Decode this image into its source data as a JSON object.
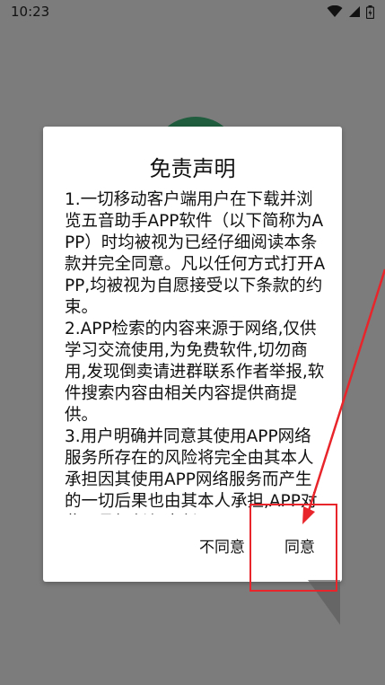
{
  "status_bar": {
    "time": "10:23"
  },
  "dialog": {
    "title": "免责声明",
    "body": "1.一切移动客户端用户在下载并浏览五音助手APP软件（以下简称为APP）时均被视为已经仔细阅读本条款并完全同意。凡以任何方式打开APP,均被视为自愿接受以下条款的约束。\n2.APP检索的内容来源于网络,仅供学习交流使用,为免费软件,切勿商用,发现倒卖请进群联系作者举报,软件搜索内容由相关内容提供商提供。\n3.用户明确并同意其使用APP网络服务所存在的风险将完全由其本人承担因其使用APP网络服务而产生的一切后果也由其本人承担,APP对此不承担任何责任。",
    "buttons": {
      "disagree": "不同意",
      "agree": "同意"
    }
  },
  "colors": {
    "scrim": "#7c7c7c",
    "accent_green": "#1f5d3e",
    "annotation_red": "#e8252a"
  },
  "icons": [
    "wifi-icon",
    "signal-icon",
    "battery-icon"
  ]
}
